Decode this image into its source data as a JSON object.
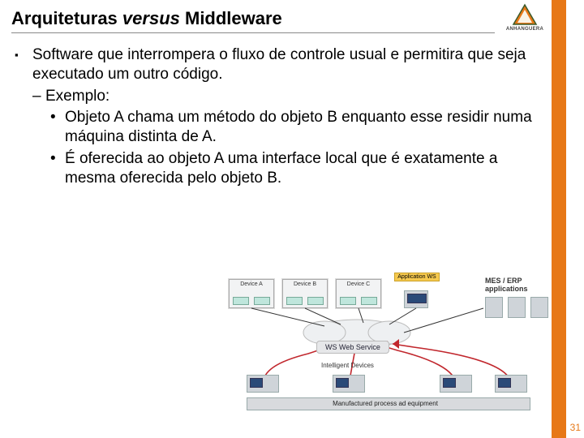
{
  "header": {
    "title_plain": "Arquiteturas ",
    "title_italic": "versus",
    "title_rest": " Middleware",
    "logo_label": "ANHANGUERA"
  },
  "body": {
    "bullet": "▪",
    "main": "Software que interrompera o fluxo de controle usual e permitira que seja executado um outro código.",
    "example_marker": "–",
    "example_label": "Exemplo:",
    "sub_marker": "•",
    "sub1": "Objeto A chama um método do objeto B enquanto esse residir numa máquina distinta de A.",
    "sub2": "É oferecida ao objeto A uma interface local que é exatamente a  mesma oferecida pelo objeto B."
  },
  "diagram": {
    "device_a": "Device A",
    "device_b": "Device B",
    "device_c": "Device C",
    "app_label": "Application WS",
    "mes_label": "MES / ERP applications",
    "ws_label": "WS Web Service",
    "intelligent": "Intelligent Devices",
    "bottom_caption": "Manufactured process ad equipment"
  },
  "page_number": "31"
}
